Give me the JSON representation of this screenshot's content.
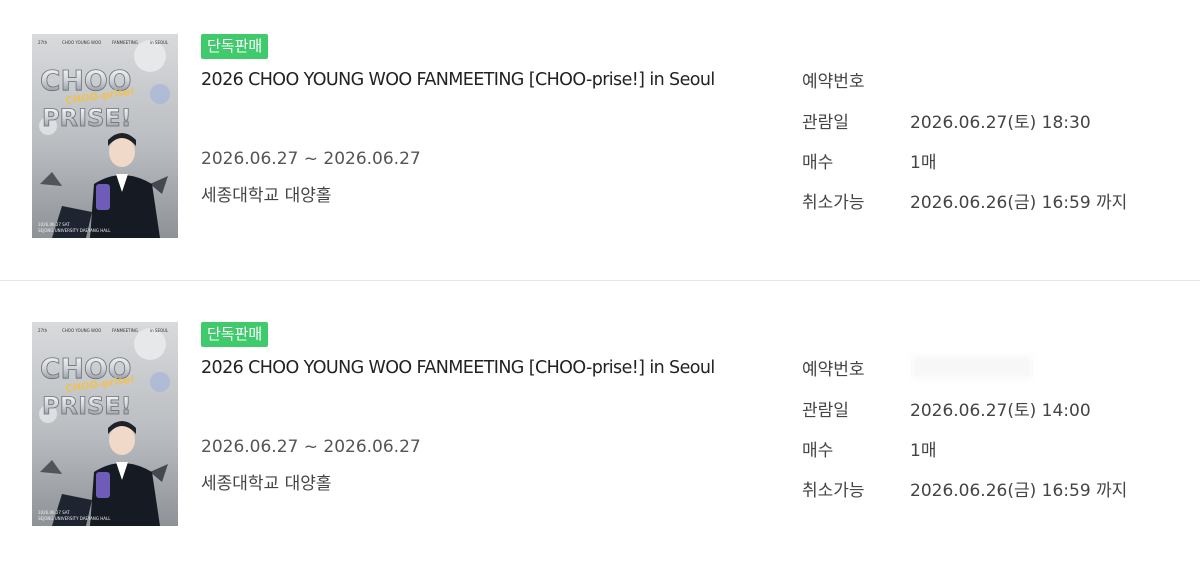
{
  "colors": {
    "badge_bg": "#3fca6b",
    "divider": "#e6e6e6",
    "text": "#444444"
  },
  "poster": {
    "top_line_1": "27th",
    "top_line_2": "CHOO YOUNG WOO",
    "top_line_3": "FANMEETING",
    "top_line_4": "in SEOUL",
    "logo_line_1": "CHOO",
    "logo_line_2": "PRISE!",
    "logo_sub": "CHOO-prise!",
    "bottom_line_1": "2026.06.27 SAT",
    "bottom_line_2": "SEJONG UNIVERSITY DAEYANG HALL"
  },
  "bookings": [
    {
      "badge": "단독판매",
      "title": "2026 CHOO YOUNG WOO FANMEETING [CHOO-prise!] in Seoul",
      "period": "2026.06.27 ~ 2026.06.27",
      "venue": "세종대학교 대양홀",
      "reservation_label": "예약번호",
      "reservation_value": "",
      "view_date_label": "관람일",
      "view_date_value": "2026.06.27(토) 18:30",
      "tickets_label": "매수",
      "tickets_value": "1매",
      "cancel_label": "취소가능",
      "cancel_value": "2026.06.26(금) 16:59 까지"
    },
    {
      "badge": "단독판매",
      "title": "2026 CHOO YOUNG WOO FANMEETING [CHOO-prise!] in Seoul",
      "period": "2026.06.27 ~ 2026.06.27",
      "venue": "세종대학교 대양홀",
      "reservation_label": "예약번호",
      "reservation_value": "",
      "view_date_label": "관람일",
      "view_date_value": "2026.06.27(토) 14:00",
      "tickets_label": "매수",
      "tickets_value": "1매",
      "cancel_label": "취소가능",
      "cancel_value": "2026.06.26(금) 16:59 까지"
    }
  ]
}
